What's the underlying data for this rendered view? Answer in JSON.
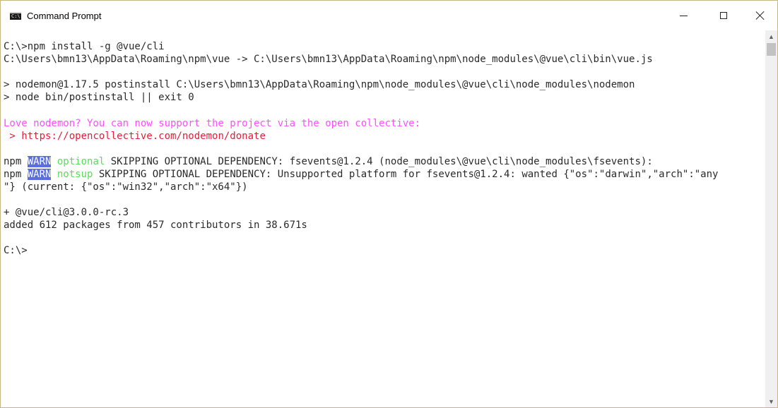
{
  "window": {
    "title": "Command Prompt",
    "icon": "console-app-icon",
    "icon_glyph": "C:\\"
  },
  "caption_buttons": [
    "minimize",
    "maximize",
    "close"
  ],
  "colors": {
    "magenta_text": "#ff4dff",
    "red_text": "#e0203a",
    "warn_highlight": "#5b6ee0",
    "green_text": "#55e055"
  },
  "console": {
    "cmd_install": "C:\\>npm install -g @vue/cli",
    "cmd_link": "C:\\Users\\bmn13\\AppData\\Roaming\\npm\\vue -> C:\\Users\\bmn13\\AppData\\Roaming\\npm\\node_modules\\@vue\\cli\\bin\\vue.js",
    "postinstall_1": "> nodemon@1.17.5 postinstall C:\\Users\\bmn13\\AppData\\Roaming\\npm\\node_modules\\@vue\\cli\\node_modules\\nodemon",
    "postinstall_2": "> node bin/postinstall || exit 0",
    "support_msg": "Love nodemon? You can now support the project via the open collective:",
    "donate_prefix": " > ",
    "donate_url": "https://opencollective.com/nodemon/donate",
    "warn1": {
      "npm": "npm ",
      "warn": "WARN",
      "space": " ",
      "tag": "optional",
      "message": " SKIPPING OPTIONAL DEPENDENCY: fsevents@1.2.4 (node_modules\\@vue\\cli\\node_modules\\fsevents):"
    },
    "warn2": {
      "npm": "npm ",
      "warn": "WARN",
      "space": " ",
      "tag": "notsup",
      "message": " SKIPPING OPTIONAL DEPENDENCY: Unsupported platform for fsevents@1.2.4: wanted {\"os\":\"darwin\",\"arch\":\"any"
    },
    "warn2_cont": "\"} (current: {\"os\":\"win32\",\"arch\":\"x64\"})",
    "installed_pkg": "+ @vue/cli@3.0.0-rc.3",
    "summary": "added 612 packages from 457 contributors in 38.671s",
    "prompt": "C:\\>"
  }
}
